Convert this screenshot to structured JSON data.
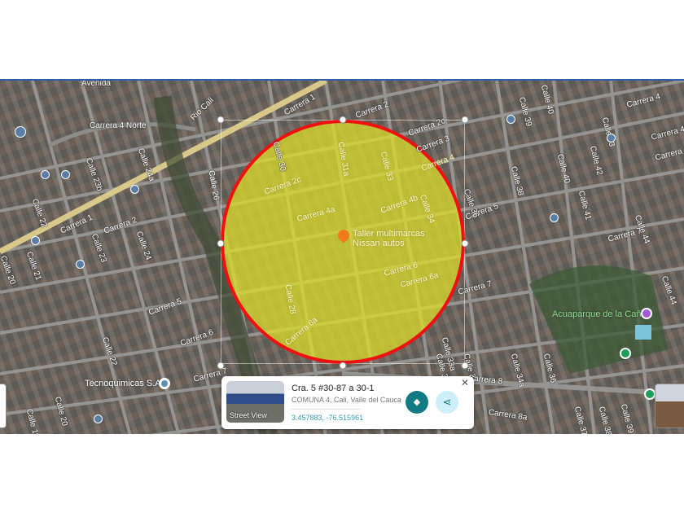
{
  "map": {
    "streets": [
      "Carrera 4 Norte",
      "Rio Cali",
      "Carrera 1",
      "Carrera 1",
      "Carrera 2",
      "Calle 22",
      "Calle 23",
      "Calle 24",
      "Calle 23b",
      "Calle 24a",
      "Calle 26",
      "Carrera 2c",
      "Carrera 4a",
      "Calle 31a",
      "Calle 33",
      "Carrera 4b",
      "Calle 34",
      "Carrera 2",
      "Carrera 2c",
      "Carrera 3",
      "Carrera 4",
      "Carrera 5",
      "Calle 36",
      "Calle 38",
      "Calle 39",
      "Calle 40",
      "Calle 40",
      "Calle 42",
      "Calle 43",
      "Calle 41",
      "Carrera 4",
      "Carrera 4b",
      "Carrera 5",
      "Calle 44",
      "Carrera 6",
      "Carrera 6a",
      "Carrera 7",
      "Carrera 7",
      "Calle 44",
      "Calle 33a",
      "Calle 34",
      "Calle 33",
      "Calle 34a",
      "Calle 36",
      "Carrera 8",
      "Carrera 8a",
      "Calle 37",
      "Calle 38",
      "Calle 39",
      "Carrera 5",
      "Carrera 6",
      "Carrera 7",
      "Calle 22",
      "Calle 21",
      "Calle 20",
      "Calle 20",
      "Calle 19",
      "Calle 28",
      "Carrera 6a",
      "Calle 30",
      "Avenida"
    ],
    "pois": {
      "taller": "Taller multimarcas Nissan autos",
      "acuaparque": "Acuaparque de la Caña",
      "tecnoquimicas": "Tecnoquimicas S.A"
    },
    "colors": {
      "circle_border": "#f01010",
      "circle_fill": "#e1e128",
      "marker": "#f07a1a"
    }
  },
  "card": {
    "address": "Cra. 5 #30-87 a 30-1",
    "locality": "COMUNA 4, Cali, Valle del Cauca",
    "coords": "3.457883, -76.515961",
    "street_view": "Street View",
    "close": "✕",
    "directions_icon": "◆",
    "share_icon": "⋖"
  }
}
